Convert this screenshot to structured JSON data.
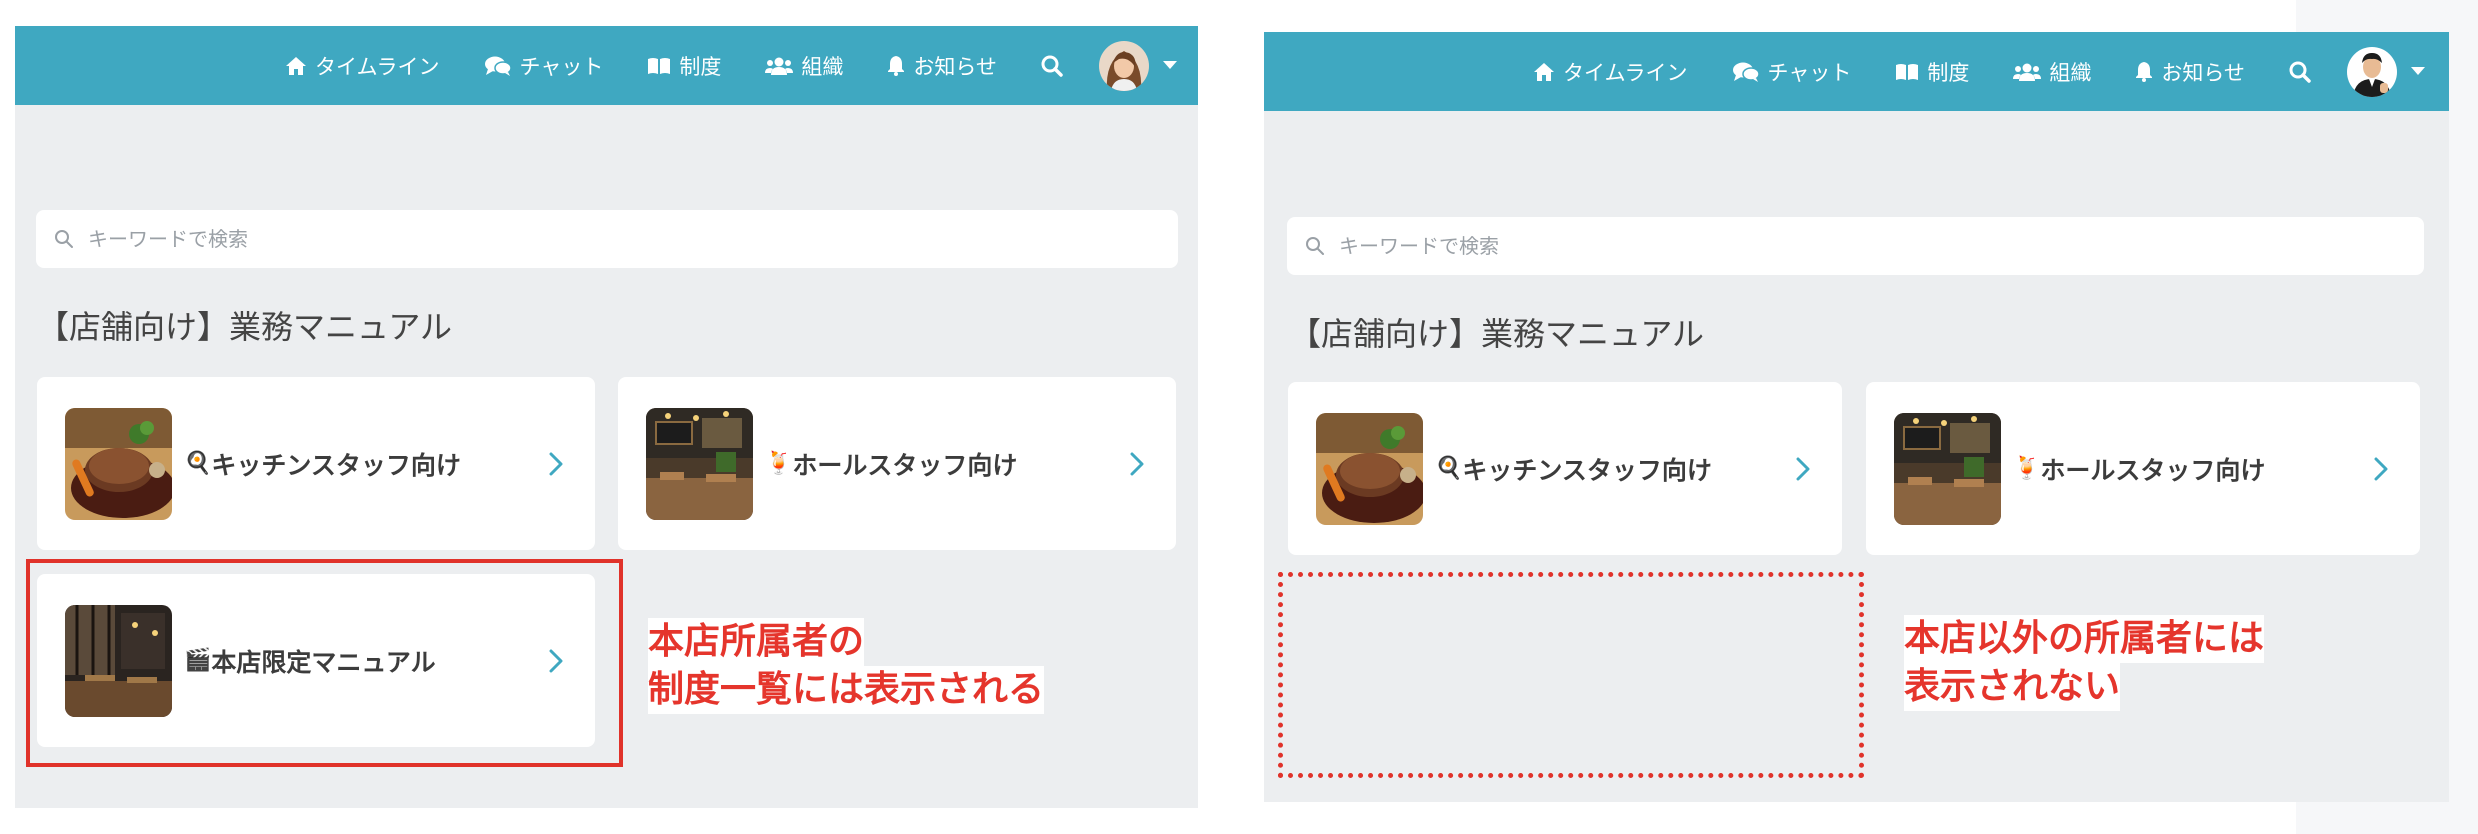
{
  "colors": {
    "header_bg": "#3fa8c1",
    "panel_bg": "#eceef0",
    "annotation_red": "#e0322a"
  },
  "nav": {
    "timeline": "タイムライン",
    "chat": "チャット",
    "system": "制度",
    "organization": "組織",
    "notifications": "お知らせ"
  },
  "search": {
    "placeholder": "キーワードで検索"
  },
  "section_title": "【店舗向け】業務マニュアル",
  "cards": {
    "kitchen": {
      "emoji": "🍳",
      "label": "キッチンスタッフ向け",
      "icon": "frying-pan"
    },
    "hall": {
      "emoji": "🍹",
      "label": "ホールスタッフ向け",
      "icon": "tropical-drink"
    },
    "main_store": {
      "emoji": "🎬",
      "label": "本店限定マニュアル",
      "icon": "clapper"
    }
  },
  "annotations": {
    "left": {
      "line1": "本店所属者の",
      "line2": "制度一覧には表示される"
    },
    "right": {
      "line1": "本店以外の所属者には",
      "line2": "表示されない"
    }
  }
}
